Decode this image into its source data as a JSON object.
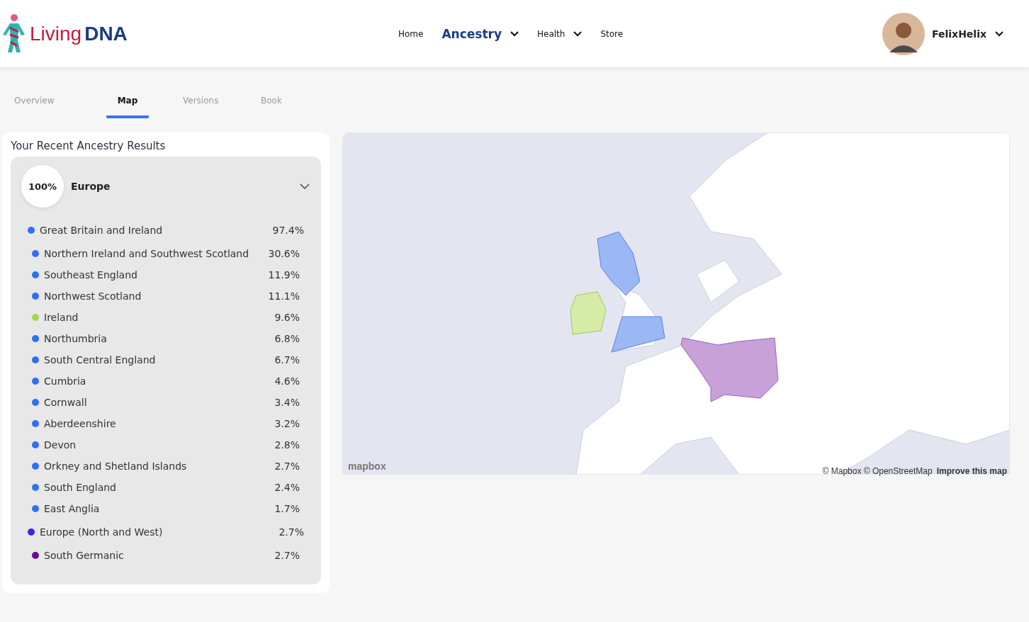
{
  "logo": {
    "word_1": "Living",
    "word_2": "DNA"
  },
  "nav": [
    {
      "label": "Home",
      "selected": false,
      "dropdown": false
    },
    {
      "label": "Ancestry",
      "selected": true,
      "dropdown": true
    },
    {
      "label": "Health",
      "selected": false,
      "dropdown": true
    },
    {
      "label": "Store",
      "selected": false,
      "dropdown": false
    }
  ],
  "user": {
    "name": "FelixHelix"
  },
  "tabs": [
    {
      "label": "Overview",
      "selected": false
    },
    {
      "label": "Map",
      "selected": true
    },
    {
      "label": "Versions",
      "selected": false
    },
    {
      "label": "Book",
      "selected": false
    }
  ],
  "results": {
    "title": "Your Recent Ancestry Results",
    "region": {
      "percent": "100%",
      "name": "Europe",
      "expanded": true
    },
    "items": [
      {
        "name": "Great Britain and Ireland",
        "percent": "97.4%",
        "color": "#2f6ff5",
        "children": [
          {
            "name": "Northern Ireland and Southwest Scotland",
            "percent": "30.6%",
            "color": "#2f6ff5"
          },
          {
            "name": "Southeast England",
            "percent": "11.9%",
            "color": "#2f6ff5"
          },
          {
            "name": "Northwest Scotland",
            "percent": "11.1%",
            "color": "#2f6ff5"
          },
          {
            "name": "Ireland",
            "percent": "9.6%",
            "color": "#a3d84a"
          },
          {
            "name": "Northumbria",
            "percent": "6.8%",
            "color": "#2f6ff5"
          },
          {
            "name": "South Central England",
            "percent": "6.7%",
            "color": "#2f6ff5"
          },
          {
            "name": "Cumbria",
            "percent": "4.6%",
            "color": "#2f6ff5"
          },
          {
            "name": "Cornwall",
            "percent": "3.4%",
            "color": "#2f6ff5"
          },
          {
            "name": "Aberdeenshire",
            "percent": "3.2%",
            "color": "#2f6ff5"
          },
          {
            "name": "Devon",
            "percent": "2.8%",
            "color": "#2f6ff5"
          },
          {
            "name": "Orkney and Shetland Islands",
            "percent": "2.7%",
            "color": "#2f6ff5"
          },
          {
            "name": "South England",
            "percent": "2.4%",
            "color": "#2f6ff5"
          },
          {
            "name": "East Anglia",
            "percent": "1.7%",
            "color": "#2f6ff5"
          }
        ]
      },
      {
        "name": "Europe (North and West)",
        "percent": "2.7%",
        "color": "#4a1fe0",
        "children": [
          {
            "name": "South Germanic",
            "percent": "2.7%",
            "color": "#6a0a90"
          }
        ]
      }
    ]
  },
  "map": {
    "logo": "mapbox",
    "attribution": "© Mapbox © OpenStreetMap",
    "improve_link": "Improve this map"
  }
}
